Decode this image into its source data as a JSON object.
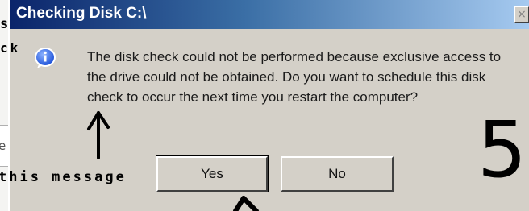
{
  "window": {
    "title": "Checking Disk C:\\",
    "close_glyph": "×"
  },
  "dialog": {
    "icon": "info-icon",
    "message": "The disk check could not be performed because exclusive access to the drive could not be obtained. Do you want to schedule this disk check to occur the next time you restart the computer?",
    "buttons": {
      "yes": "Yes",
      "no": "No"
    }
  },
  "annotations": {
    "top_left_letter_1": "s",
    "top_left_letter_2": "ck",
    "bottom_label": "this message",
    "step_number": "5"
  },
  "backdrop": {
    "partial_text": "e"
  },
  "colors": {
    "titlebar_start": "#0a246a",
    "titlebar_end": "#a6caf0",
    "dialog_bg": "#d4d0c8",
    "info_icon_blue": "#1a4fd8"
  }
}
